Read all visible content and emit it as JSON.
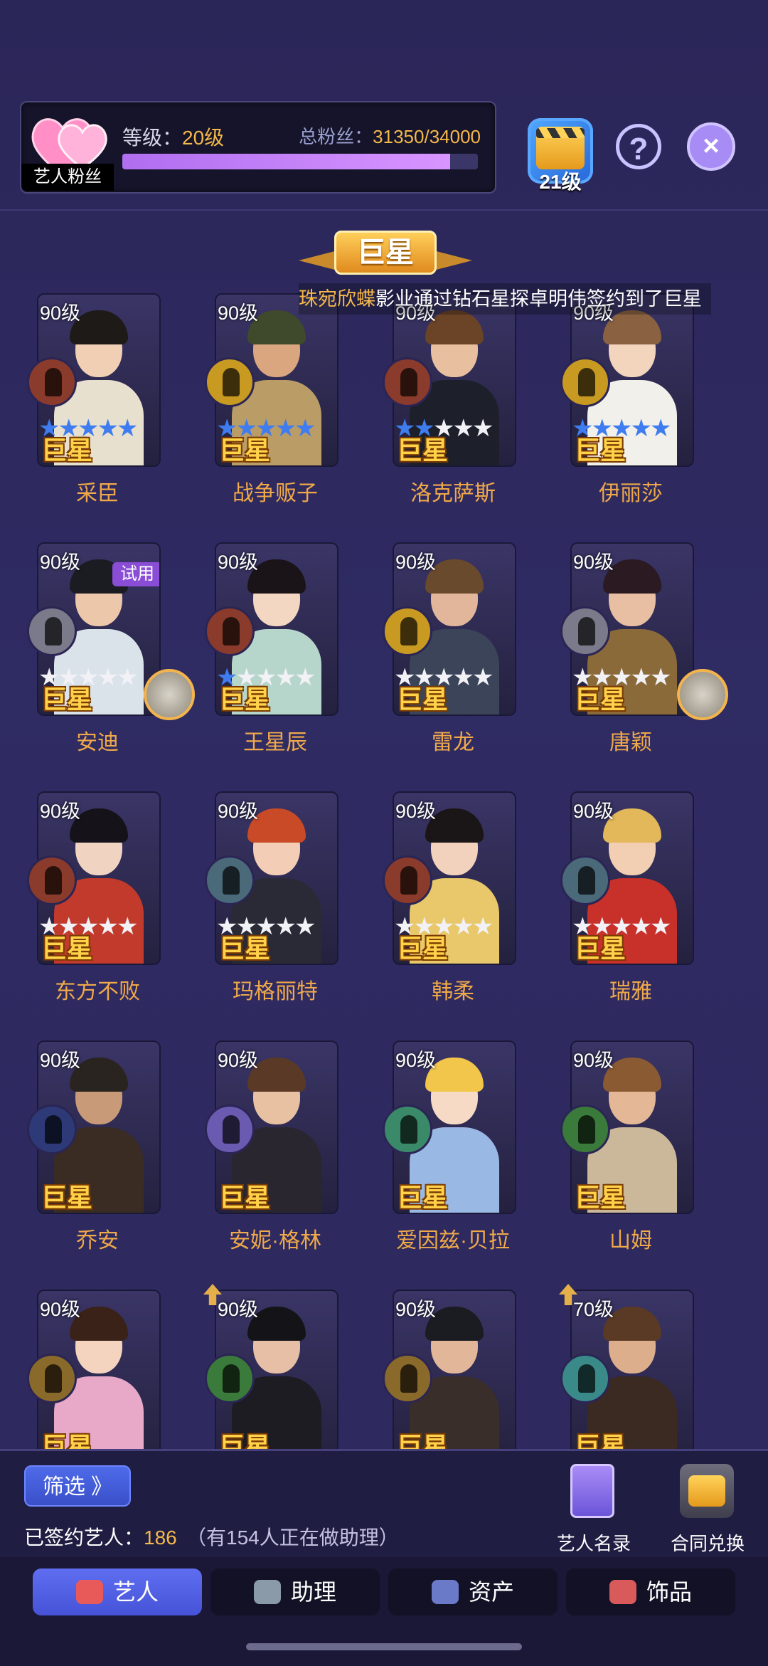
{
  "fan_panel": {
    "tag": "艺人粉丝",
    "level_prefix": "等级：",
    "level_value": "20级",
    "fans_prefix": "总粉丝：",
    "fans_value": "31350/34000",
    "fans_progress": 0.922
  },
  "clapper_level": "21级",
  "help_symbol": "?",
  "close_symbol": "×",
  "section_title": "巨星",
  "marquee": {
    "highlight": "珠宛欣蝶",
    "text": "影业通过钻石星探卓明伟签约到了巨星"
  },
  "rank_label": "巨星",
  "trial_label": "试用",
  "artists": [
    {
      "name": "采臣",
      "level": "90级",
      "stars": 5,
      "genre_color": "#8a3b2b",
      "skin": "#f0cfb4",
      "hair": "#1e1a18",
      "body": "#e8e0cf"
    },
    {
      "name": "战争贩子",
      "level": "90级",
      "stars": 5,
      "genre_color": "#c89a22",
      "skin": "#d9a67f",
      "hair": "#3f4a2c",
      "body": "#b99c66"
    },
    {
      "name": "洛克萨斯",
      "level": "90级",
      "stars": 2,
      "genre_color": "#8a3b2b",
      "skin": "#e8c0a0",
      "hair": "#6b4326",
      "body": "#1d1f2a"
    },
    {
      "name": "伊丽莎",
      "level": "90级",
      "stars": 5,
      "genre_color": "#c89a22",
      "skin": "#f3d4bd",
      "hair": "#8a6242",
      "body": "#f2f0ea"
    },
    {
      "name": "安迪",
      "level": "90级",
      "stars": 0,
      "genre_color": "#7b7a8a",
      "skin": "#ecc7aa",
      "hair": "#1b1b22",
      "body": "#dbe3ea",
      "trial": true,
      "accessory": true
    },
    {
      "name": "王星辰",
      "level": "90级",
      "stars": 1,
      "genre_color": "#8a3b2b",
      "skin": "#f3d7c3",
      "hair": "#1a1418",
      "body": "#b7d6cb"
    },
    {
      "name": "雷龙",
      "level": "90级",
      "stars": 0,
      "genre_color": "#c89a22",
      "skin": "#e1b69a",
      "hair": "#6a4a2c",
      "body": "#3b4458"
    },
    {
      "name": "唐颖",
      "level": "90级",
      "stars": 0,
      "genre_color": "#7b7a8a",
      "skin": "#e9bfa3",
      "hair": "#2b1a22",
      "body": "#8b6a3a",
      "accessory": true
    },
    {
      "name": "东方不败",
      "level": "90级",
      "stars": 0,
      "genre_color": "#8a3b2b",
      "skin": "#f1d3c2",
      "hair": "#15121a",
      "body": "#c23a2c"
    },
    {
      "name": "玛格丽特",
      "level": "90级",
      "stars": 0,
      "genre_color": "#4a6a7a",
      "skin": "#f3cdb5",
      "hair": "#c84a26",
      "body": "#2a2a36"
    },
    {
      "name": "韩柔",
      "level": "90级",
      "stars": 0,
      "genre_color": "#8a3b2b",
      "skin": "#f2d2bc",
      "hair": "#1a1516",
      "body": "#e8c86a"
    },
    {
      "name": "瑞雅",
      "level": "90级",
      "stars": 0,
      "genre_color": "#4a6a7a",
      "skin": "#f2cfb3",
      "hair": "#e2b85a",
      "body": "#c8302a"
    },
    {
      "name": "乔安",
      "level": "90级",
      "stars": -1,
      "genre_color": "#2e3a78",
      "skin": "#c99a78",
      "hair": "#2a2420",
      "body": "#3a2c22"
    },
    {
      "name": "安妮·格林",
      "level": "90级",
      "stars": -1,
      "genre_color": "#6a5ab0",
      "skin": "#e8c0a2",
      "hair": "#5a3a26",
      "body": "#2a2630"
    },
    {
      "name": "爱因兹·贝拉",
      "level": "90级",
      "stars": -1,
      "genre_color": "#3a8a6a",
      "skin": "#f6dac6",
      "hair": "#f2c64a",
      "body": "#9ab8e4"
    },
    {
      "name": "山姆",
      "level": "90级",
      "stars": -1,
      "genre_color": "#3a7a3a",
      "skin": "#e4b896",
      "hair": "#8a5a32",
      "body": "#cbb89a"
    },
    {
      "name": "",
      "level": "90级",
      "stars": -1,
      "genre_color": "#8a6a2a",
      "skin": "#f4d4bf",
      "hair": "#3a2218",
      "body": "#e8a8c8"
    },
    {
      "name": "",
      "level": "90级",
      "stars": -1,
      "genre_color": "#3a7a3a",
      "skin": "#e6bfa6",
      "hair": "#141418",
      "body": "#1c1c22",
      "up": true
    },
    {
      "name": "",
      "level": "90级",
      "stars": -1,
      "genre_color": "#8a6a2a",
      "skin": "#e2b698",
      "hair": "#1b1b22",
      "body": "#3a2e2a"
    },
    {
      "name": "",
      "level": "70级",
      "stars": -1,
      "genre_color": "#3a8a8a",
      "skin": "#dcae8c",
      "hair": "#5a3a24",
      "body": "#3b2a22",
      "up": true
    }
  ],
  "bottom": {
    "filter_label": "筛选 》",
    "signed_prefix": "已签约艺人：",
    "signed_count": "186",
    "helper_note": "（有154人正在做助理）",
    "roster_label": "艺人名录",
    "exchange_label": "合同兑换"
  },
  "tabs": [
    {
      "label": "艺人",
      "icon": "artist-icon",
      "active": true,
      "color": "#e85a5a"
    },
    {
      "label": "助理",
      "icon": "assistant-icon",
      "active": false,
      "color": "#8a9aa8"
    },
    {
      "label": "资产",
      "icon": "asset-icon",
      "active": false,
      "color": "#6a7ac8"
    },
    {
      "label": "饰品",
      "icon": "accessory-icon",
      "active": false,
      "color": "#d85a5a"
    }
  ]
}
